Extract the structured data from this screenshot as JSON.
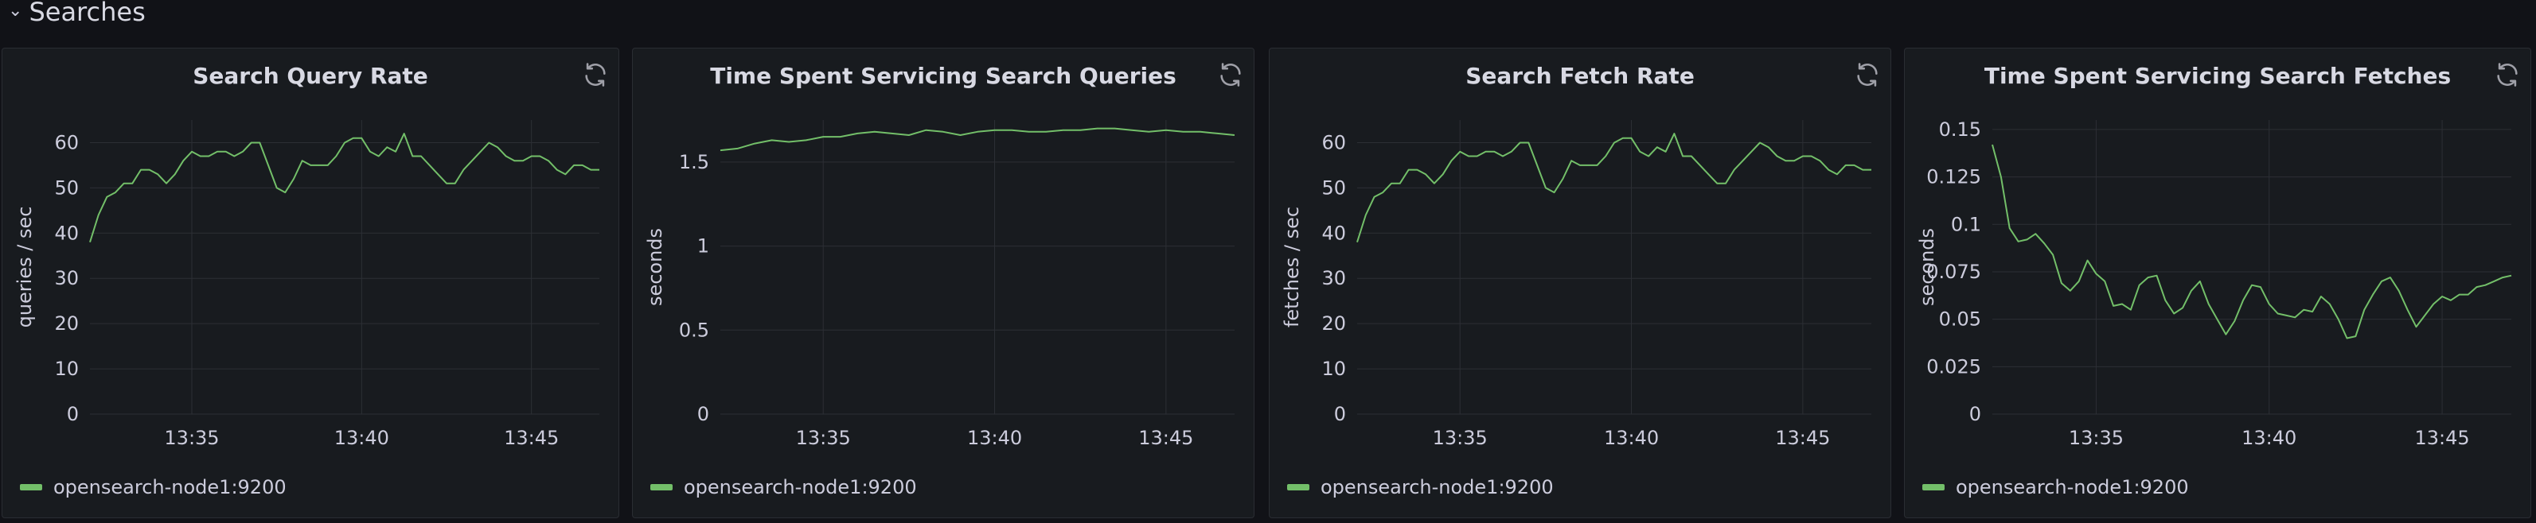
{
  "row": {
    "title": "Searches"
  },
  "legend_color": "#73bf69",
  "icons": {
    "row_toggle": "chevron-down-icon",
    "panel_action": "refresh-icon"
  },
  "chart_data": [
    {
      "type": "line",
      "title": "Search Query Rate",
      "ylabel": "queries / sec",
      "xlabel": "",
      "xlim": [
        "13:32",
        "13:47"
      ],
      "ylim": [
        0,
        65
      ],
      "yticks": [
        0,
        10,
        20,
        30,
        40,
        50,
        60
      ],
      "ytick_labels": [
        "0",
        "10",
        "20",
        "30",
        "40",
        "50",
        "60"
      ],
      "xticks": [
        "13:35",
        "13:40",
        "13:45"
      ],
      "grid": true,
      "legend_position": "bottom-left",
      "series": [
        {
          "name": "opensearch-node1:9200",
          "x": [
            "13:32:00",
            "13:32:15",
            "13:32:30",
            "13:32:45",
            "13:33:00",
            "13:33:15",
            "13:33:30",
            "13:33:45",
            "13:34:00",
            "13:34:15",
            "13:34:30",
            "13:34:45",
            "13:35:00",
            "13:35:15",
            "13:35:30",
            "13:35:45",
            "13:36:00",
            "13:36:15",
            "13:36:30",
            "13:36:45",
            "13:37:00",
            "13:37:15",
            "13:37:30",
            "13:37:45",
            "13:38:00",
            "13:38:15",
            "13:38:30",
            "13:38:45",
            "13:39:00",
            "13:39:15",
            "13:39:30",
            "13:39:45",
            "13:40:00",
            "13:40:15",
            "13:40:30",
            "13:40:45",
            "13:41:00",
            "13:41:15",
            "13:41:30",
            "13:41:45",
            "13:42:00",
            "13:42:15",
            "13:42:30",
            "13:42:45",
            "13:43:00",
            "13:43:15",
            "13:43:30",
            "13:43:45",
            "13:44:00",
            "13:44:15",
            "13:44:30",
            "13:44:45",
            "13:45:00",
            "13:45:15",
            "13:45:30",
            "13:45:45",
            "13:46:00",
            "13:46:15",
            "13:46:30",
            "13:46:45",
            "13:47:00"
          ],
          "values": [
            38,
            44,
            48,
            49,
            51,
            51,
            54,
            54,
            53,
            51,
            53,
            56,
            58,
            57,
            57,
            58,
            58,
            57,
            58,
            60,
            60,
            55,
            50,
            49,
            52,
            56,
            55,
            55,
            55,
            57,
            60,
            61,
            61,
            58,
            57,
            59,
            58,
            62,
            57,
            57,
            55,
            53,
            51,
            51,
            54,
            56,
            58,
            60,
            59,
            57,
            56,
            56,
            57,
            57,
            56,
            54,
            53,
            55,
            55,
            54,
            54
          ]
        }
      ]
    },
    {
      "type": "line",
      "title": "Time Spent Servicing Search Queries",
      "ylabel": "seconds",
      "xlabel": "",
      "xlim": [
        "13:32",
        "13:47"
      ],
      "ylim": [
        0,
        1.75
      ],
      "yticks": [
        0,
        0.5,
        1,
        1.5
      ],
      "ytick_labels": [
        "0",
        "0.5",
        "1",
        "1.5"
      ],
      "xticks": [
        "13:35",
        "13:40",
        "13:45"
      ],
      "grid": true,
      "legend_position": "bottom-left",
      "series": [
        {
          "name": "opensearch-node1:9200",
          "x": [
            "13:32:00",
            "13:32:30",
            "13:33:00",
            "13:33:30",
            "13:34:00",
            "13:34:30",
            "13:35:00",
            "13:35:30",
            "13:36:00",
            "13:36:30",
            "13:37:00",
            "13:37:30",
            "13:38:00",
            "13:38:30",
            "13:39:00",
            "13:39:30",
            "13:40:00",
            "13:40:30",
            "13:41:00",
            "13:41:30",
            "13:42:00",
            "13:42:30",
            "13:43:00",
            "13:43:30",
            "13:44:00",
            "13:44:30",
            "13:45:00",
            "13:45:30",
            "13:46:00",
            "13:46:30",
            "13:47:00"
          ],
          "values": [
            1.57,
            1.58,
            1.61,
            1.63,
            1.62,
            1.63,
            1.65,
            1.65,
            1.67,
            1.68,
            1.67,
            1.66,
            1.69,
            1.68,
            1.66,
            1.68,
            1.69,
            1.69,
            1.68,
            1.68,
            1.69,
            1.69,
            1.7,
            1.7,
            1.69,
            1.68,
            1.69,
            1.68,
            1.68,
            1.67,
            1.66
          ]
        }
      ]
    },
    {
      "type": "line",
      "title": "Search Fetch Rate",
      "ylabel": "fetches / sec",
      "xlabel": "",
      "xlim": [
        "13:32",
        "13:47"
      ],
      "ylim": [
        0,
        65
      ],
      "yticks": [
        0,
        10,
        20,
        30,
        40,
        50,
        60
      ],
      "ytick_labels": [
        "0",
        "10",
        "20",
        "30",
        "40",
        "50",
        "60"
      ],
      "xticks": [
        "13:35",
        "13:40",
        "13:45"
      ],
      "grid": true,
      "legend_position": "bottom-left",
      "series": [
        {
          "name": "opensearch-node1:9200",
          "x": [
            "13:32:00",
            "13:32:15",
            "13:32:30",
            "13:32:45",
            "13:33:00",
            "13:33:15",
            "13:33:30",
            "13:33:45",
            "13:34:00",
            "13:34:15",
            "13:34:30",
            "13:34:45",
            "13:35:00",
            "13:35:15",
            "13:35:30",
            "13:35:45",
            "13:36:00",
            "13:36:15",
            "13:36:30",
            "13:36:45",
            "13:37:00",
            "13:37:15",
            "13:37:30",
            "13:37:45",
            "13:38:00",
            "13:38:15",
            "13:38:30",
            "13:38:45",
            "13:39:00",
            "13:39:15",
            "13:39:30",
            "13:39:45",
            "13:40:00",
            "13:40:15",
            "13:40:30",
            "13:40:45",
            "13:41:00",
            "13:41:15",
            "13:41:30",
            "13:41:45",
            "13:42:00",
            "13:42:15",
            "13:42:30",
            "13:42:45",
            "13:43:00",
            "13:43:15",
            "13:43:30",
            "13:43:45",
            "13:44:00",
            "13:44:15",
            "13:44:30",
            "13:44:45",
            "13:45:00",
            "13:45:15",
            "13:45:30",
            "13:45:45",
            "13:46:00",
            "13:46:15",
            "13:46:30",
            "13:46:45",
            "13:47:00"
          ],
          "values": [
            38,
            44,
            48,
            49,
            51,
            51,
            54,
            54,
            53,
            51,
            53,
            56,
            58,
            57,
            57,
            58,
            58,
            57,
            58,
            60,
            60,
            55,
            50,
            49,
            52,
            56,
            55,
            55,
            55,
            57,
            60,
            61,
            61,
            58,
            57,
            59,
            58,
            62,
            57,
            57,
            55,
            53,
            51,
            51,
            54,
            56,
            58,
            60,
            59,
            57,
            56,
            56,
            57,
            57,
            56,
            54,
            53,
            55,
            55,
            54,
            54
          ]
        }
      ]
    },
    {
      "type": "line",
      "title": "Time Spent Servicing Search Fetches",
      "ylabel": "seconds",
      "xlabel": "",
      "xlim": [
        "13:32",
        "13:47"
      ],
      "ylim": [
        0,
        0.155
      ],
      "yticks": [
        0,
        0.025,
        0.05,
        0.075,
        0.1,
        0.125,
        0.15
      ],
      "ytick_labels": [
        "0",
        "0.025",
        "0.05",
        "0.075",
        "0.1",
        "0.125",
        "0.15"
      ],
      "xticks": [
        "13:35",
        "13:40",
        "13:45"
      ],
      "grid": true,
      "legend_position": "bottom-left",
      "series": [
        {
          "name": "opensearch-node1:9200",
          "x": [
            "13:32:00",
            "13:32:15",
            "13:32:30",
            "13:32:45",
            "13:33:00",
            "13:33:15",
            "13:33:30",
            "13:33:45",
            "13:34:00",
            "13:34:15",
            "13:34:30",
            "13:34:45",
            "13:35:00",
            "13:35:15",
            "13:35:30",
            "13:35:45",
            "13:36:00",
            "13:36:15",
            "13:36:30",
            "13:36:45",
            "13:37:00",
            "13:37:15",
            "13:37:30",
            "13:37:45",
            "13:38:00",
            "13:38:15",
            "13:38:30",
            "13:38:45",
            "13:39:00",
            "13:39:15",
            "13:39:30",
            "13:39:45",
            "13:40:00",
            "13:40:15",
            "13:40:30",
            "13:40:45",
            "13:41:00",
            "13:41:15",
            "13:41:30",
            "13:41:45",
            "13:42:00",
            "13:42:15",
            "13:42:30",
            "13:42:45",
            "13:43:00",
            "13:43:15",
            "13:43:30",
            "13:43:45",
            "13:44:00",
            "13:44:15",
            "13:44:30",
            "13:44:45",
            "13:45:00",
            "13:45:15",
            "13:45:30",
            "13:45:45",
            "13:46:00",
            "13:46:15",
            "13:46:30",
            "13:46:45",
            "13:47:00"
          ],
          "values": [
            0.142,
            0.125,
            0.098,
            0.091,
            0.092,
            0.095,
            0.09,
            0.084,
            0.069,
            0.065,
            0.07,
            0.081,
            0.074,
            0.07,
            0.057,
            0.058,
            0.055,
            0.068,
            0.072,
            0.073,
            0.06,
            0.053,
            0.056,
            0.065,
            0.07,
            0.058,
            0.05,
            0.042,
            0.049,
            0.06,
            0.068,
            0.067,
            0.058,
            0.053,
            0.052,
            0.051,
            0.055,
            0.054,
            0.062,
            0.058,
            0.05,
            0.04,
            0.041,
            0.055,
            0.063,
            0.07,
            0.072,
            0.065,
            0.055,
            0.046,
            0.052,
            0.058,
            0.062,
            0.06,
            0.063,
            0.063,
            0.067,
            0.068,
            0.07,
            0.072,
            0.073
          ]
        }
      ]
    }
  ]
}
